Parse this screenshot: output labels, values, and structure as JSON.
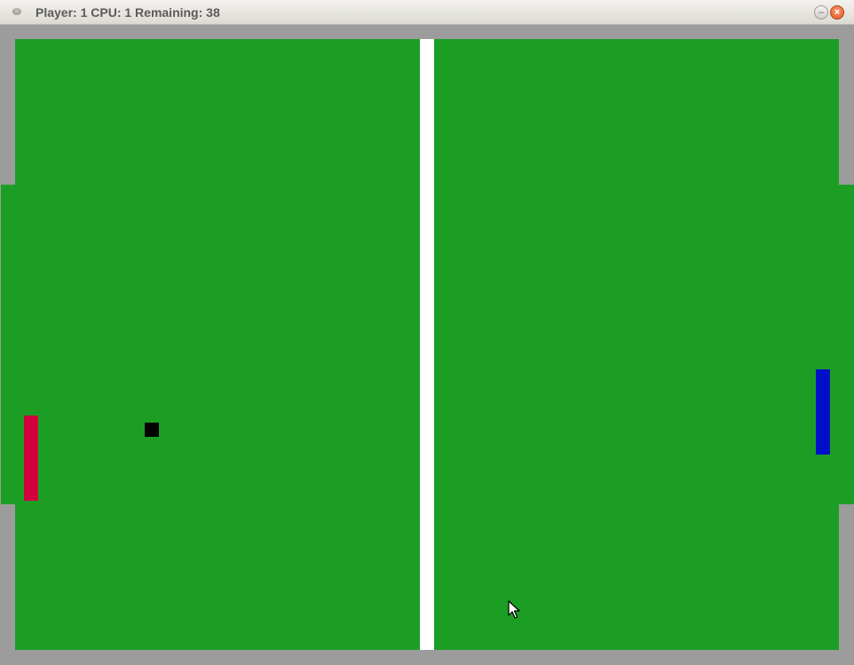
{
  "window": {
    "title": "Player: 1 CPU: 1 Remaining: 38",
    "close_symbol": "×",
    "minimize_symbol": "–"
  },
  "game": {
    "colors": {
      "field": "#1c9e25",
      "border": "#9c9c9c",
      "net": "#ffffff",
      "player_paddle": "#d2003c",
      "cpu_paddle": "#0010c8",
      "ball": "#000000"
    }
  },
  "icons": {
    "window_menu": "window-menu-icon",
    "minimize": "minimize-icon",
    "close": "close-icon",
    "cursor": "mouse-pointer-icon"
  }
}
